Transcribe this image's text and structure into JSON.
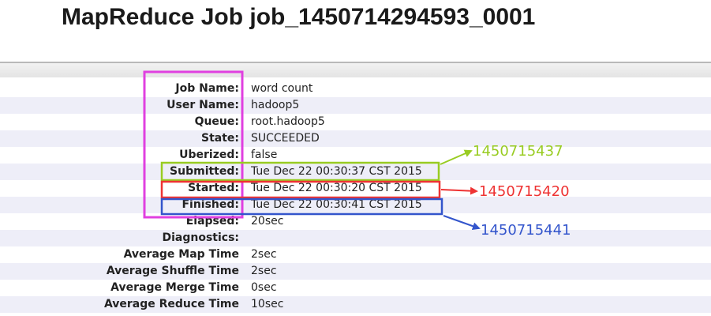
{
  "page": {
    "title": "MapReduce Job job_1450714294593_0001"
  },
  "job_info": {
    "rows": [
      {
        "label": "Job Name:",
        "value": "word count"
      },
      {
        "label": "User Name:",
        "value": "hadoop5"
      },
      {
        "label": "Queue:",
        "value": "root.hadoop5"
      },
      {
        "label": "State:",
        "value": "SUCCEEDED"
      },
      {
        "label": "Uberized:",
        "value": "false"
      },
      {
        "label": "Submitted:",
        "value": "Tue Dec 22 00:30:37 CST 2015"
      },
      {
        "label": "Started:",
        "value": "Tue Dec 22 00:30:20 CST 2015"
      },
      {
        "label": "Finished:",
        "value": "Tue Dec 22 00:30:41 CST 2015"
      },
      {
        "label": "Elapsed:",
        "value": "20sec"
      },
      {
        "label": "Diagnostics:",
        "value": ""
      },
      {
        "label": "Average Map Time",
        "value": "2sec"
      },
      {
        "label": "Average Shuffle Time",
        "value": "2sec"
      },
      {
        "label": "Average Merge Time",
        "value": "0sec"
      },
      {
        "label": "Average Reduce Time",
        "value": "10sec"
      }
    ]
  },
  "annotations": {
    "submitted_timestamp": "1450715437",
    "started_timestamp": "1450715420",
    "finished_timestamp": "1450715441"
  },
  "colors": {
    "labels_box": "#e040e0",
    "submitted": "#99cc22",
    "started": "#ee3333",
    "finished": "#3355cc",
    "row_stripe": "#eeeef8"
  }
}
